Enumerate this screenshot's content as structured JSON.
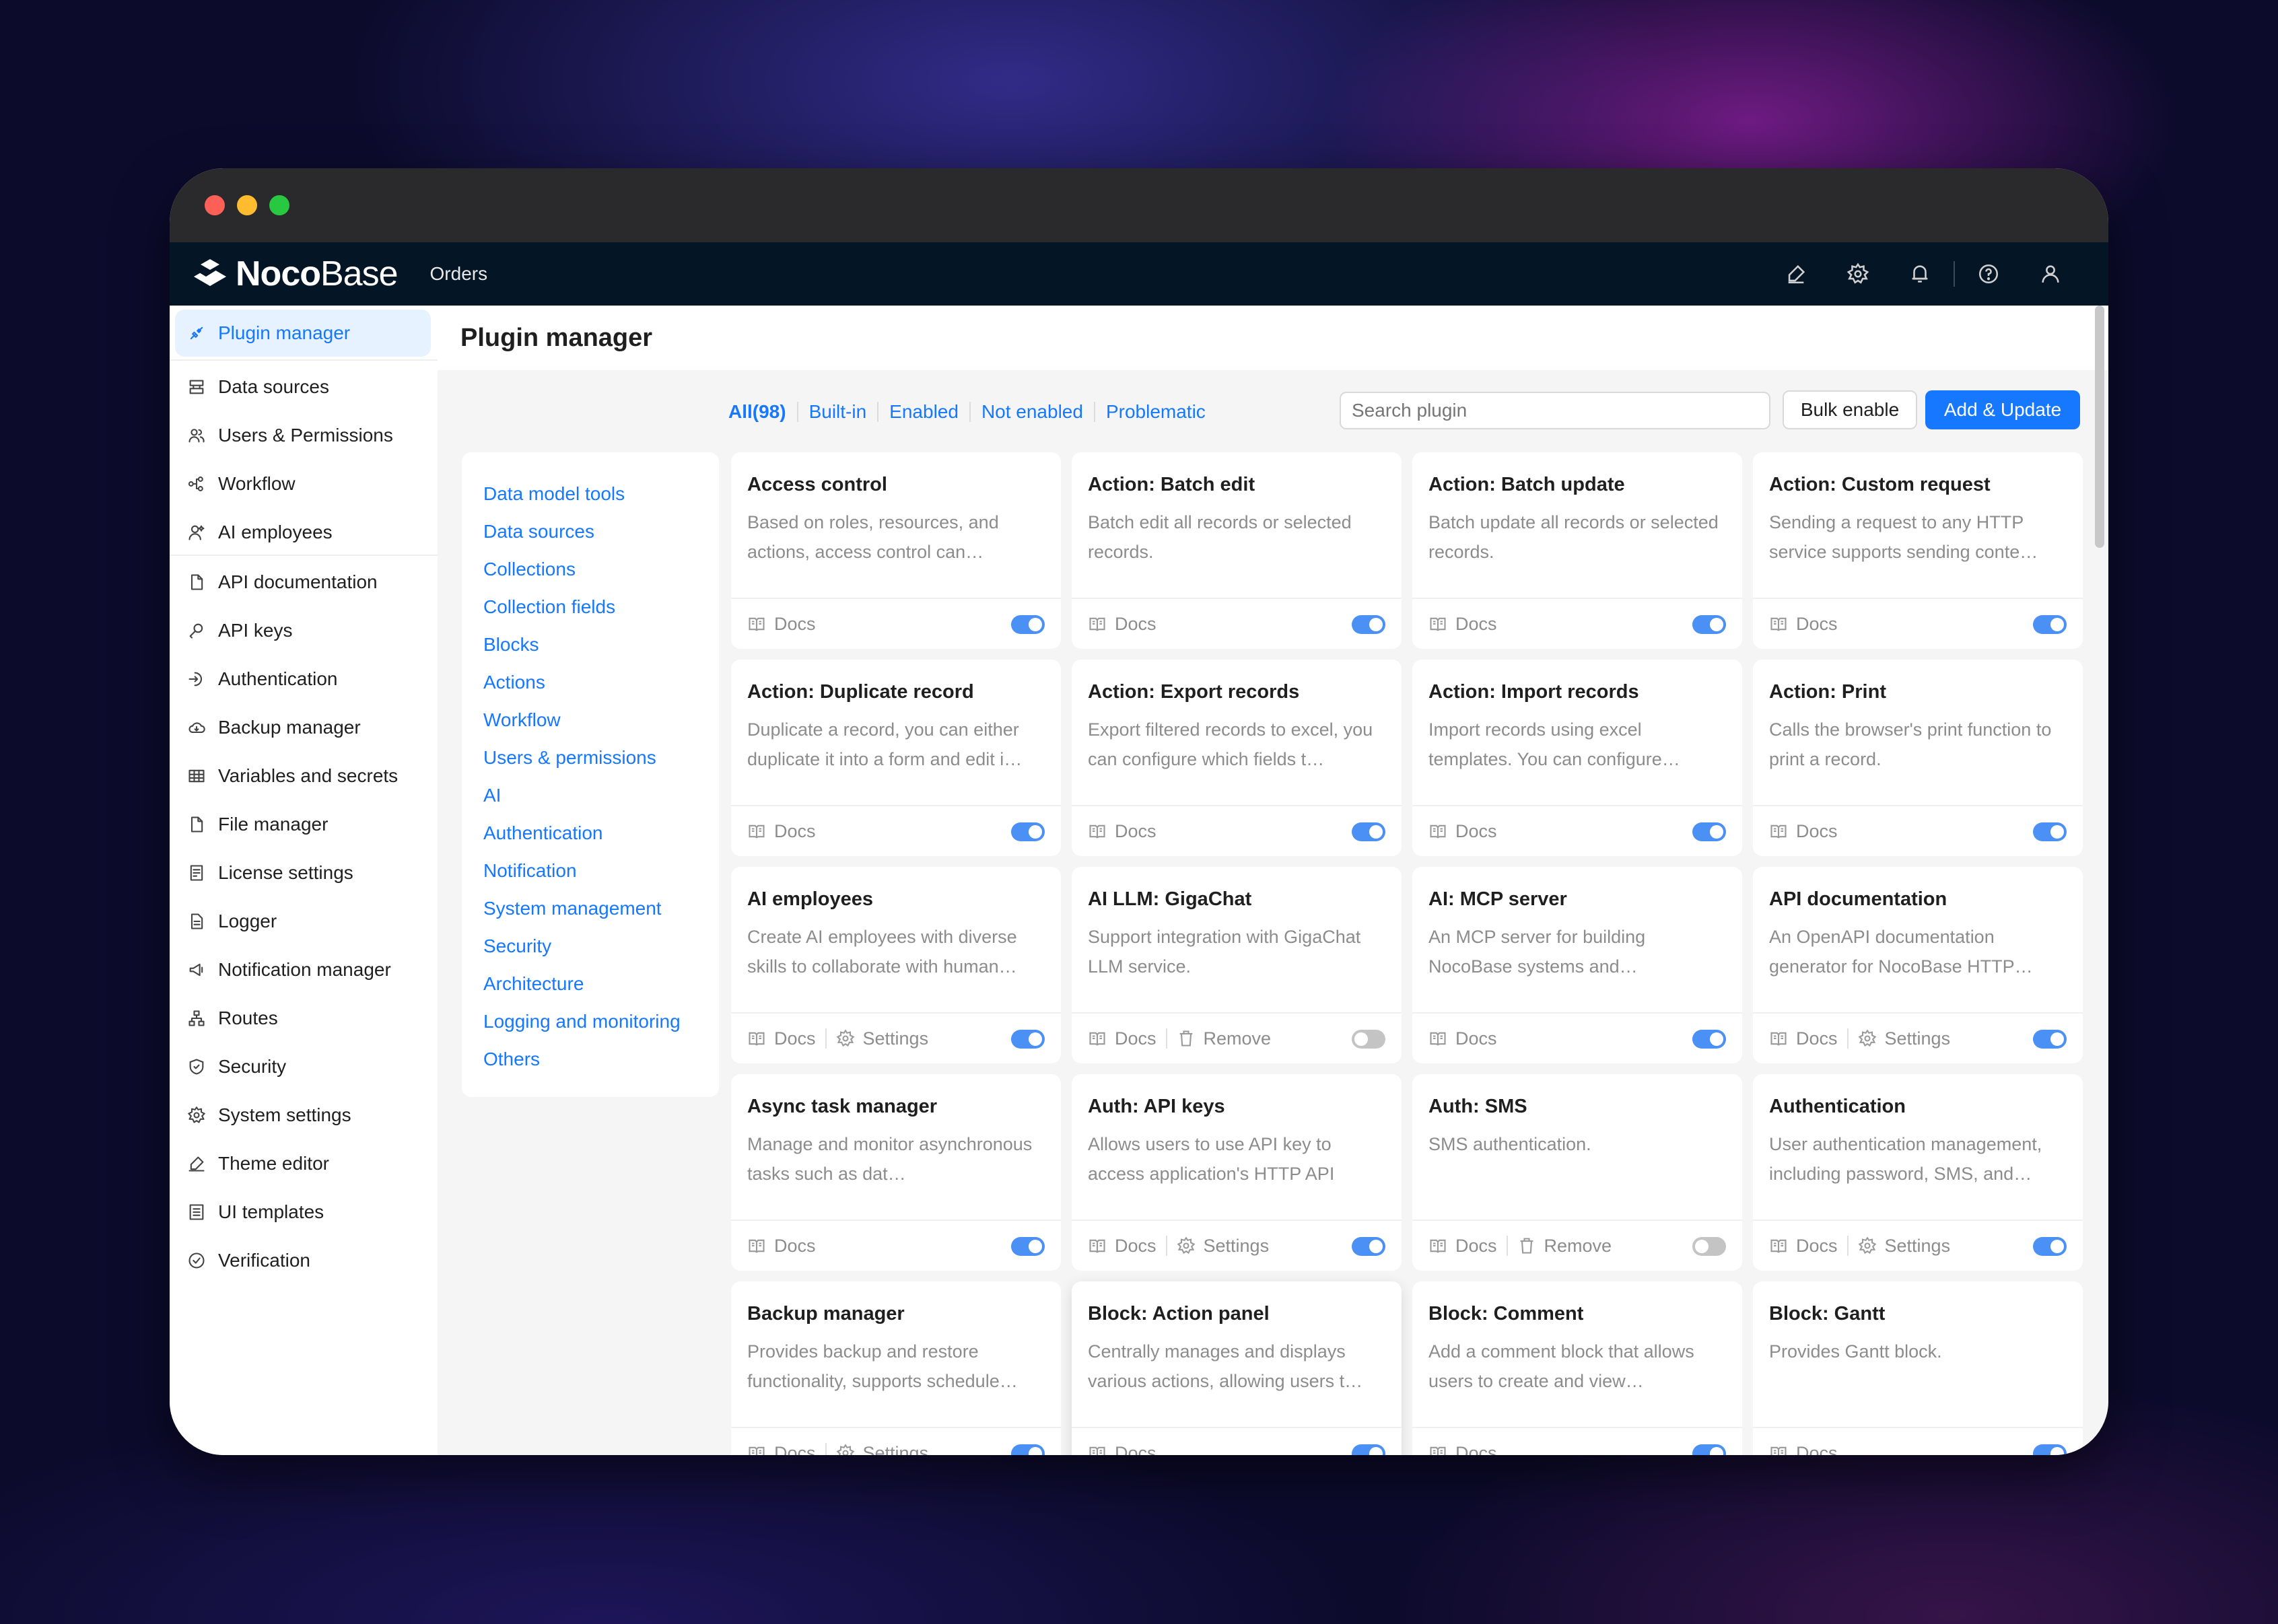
{
  "app": {
    "logo_bold": "Noco",
    "logo_light": "Base",
    "nav_item": "Orders"
  },
  "sidebar": {
    "items": [
      {
        "label": "Plugin manager",
        "icon": "plugin-icon"
      },
      {
        "label": "Data sources",
        "icon": "database-icon"
      },
      {
        "label": "Users & Permissions",
        "icon": "users-icon"
      },
      {
        "label": "Workflow",
        "icon": "workflow-icon"
      },
      {
        "label": "AI employees",
        "icon": "ai-employees-icon"
      },
      {
        "label": "API documentation",
        "icon": "document-icon"
      },
      {
        "label": "API keys",
        "icon": "key-icon"
      },
      {
        "label": "Authentication",
        "icon": "login-icon"
      },
      {
        "label": "Backup manager",
        "icon": "cloud-icon"
      },
      {
        "label": "Variables and secrets",
        "icon": "table-icon"
      },
      {
        "label": "File manager",
        "icon": "file-icon"
      },
      {
        "label": "License settings",
        "icon": "license-icon"
      },
      {
        "label": "Logger",
        "icon": "file-text-icon"
      },
      {
        "label": "Notification manager",
        "icon": "megaphone-icon"
      },
      {
        "label": "Routes",
        "icon": "routes-icon"
      },
      {
        "label": "Security",
        "icon": "shield-icon"
      },
      {
        "label": "System settings",
        "icon": "gear-icon"
      },
      {
        "label": "Theme editor",
        "icon": "brush-icon"
      },
      {
        "label": "UI templates",
        "icon": "template-icon"
      },
      {
        "label": "Verification",
        "icon": "check-circle-icon"
      }
    ]
  },
  "page": {
    "title": "Plugin manager"
  },
  "filters": [
    "All(98)",
    "Built-in",
    "Enabled",
    "Not enabled",
    "Problematic"
  ],
  "search": {
    "placeholder": "Search plugin"
  },
  "buttons": {
    "bulk": "Bulk enable",
    "add": "Add & Update"
  },
  "categories": [
    "Data model tools",
    "Data sources",
    "Collections",
    "Collection fields",
    "Blocks",
    "Actions",
    "Workflow",
    "Users & permissions",
    "AI",
    "Authentication",
    "Notification",
    "System management",
    "Security",
    "Architecture",
    "Logging and monitoring",
    "Others"
  ],
  "footer_labels": {
    "docs": "Docs",
    "settings": "Settings",
    "remove": "Remove"
  },
  "plugins": [
    {
      "title": "Access control",
      "desc": "Based on roles, resources, and actions, access control can…",
      "actions": [
        "docs"
      ],
      "enabled": true
    },
    {
      "title": "Action: Batch edit",
      "desc": "Batch edit all records or selected records.",
      "actions": [
        "docs"
      ],
      "enabled": true
    },
    {
      "title": "Action: Batch update",
      "desc": "Batch update all records or selected records.",
      "actions": [
        "docs"
      ],
      "enabled": true
    },
    {
      "title": "Action: Custom request",
      "desc": "Sending a request to any HTTP service supports sending conte…",
      "actions": [
        "docs"
      ],
      "enabled": true
    },
    {
      "title": "Action: Duplicate record",
      "desc": "Duplicate a record, you can either duplicate it into a form and edit i…",
      "actions": [
        "docs"
      ],
      "enabled": true
    },
    {
      "title": "Action: Export records",
      "desc": "Export filtered records to excel, you can configure which fields t…",
      "actions": [
        "docs"
      ],
      "enabled": true
    },
    {
      "title": "Action: Import records",
      "desc": "Import records using excel templates. You can configure…",
      "actions": [
        "docs"
      ],
      "enabled": true
    },
    {
      "title": "Action: Print",
      "desc": "Calls the browser's print function to print a record.",
      "actions": [
        "docs"
      ],
      "enabled": true
    },
    {
      "title": "AI employees",
      "desc": "Create AI employees with diverse skills to collaborate with human…",
      "actions": [
        "docs",
        "settings"
      ],
      "enabled": true
    },
    {
      "title": "AI LLM: GigaChat",
      "desc": "Support integration with GigaChat LLM service.",
      "actions": [
        "docs",
        "remove"
      ],
      "enabled": false
    },
    {
      "title": "AI: MCP server",
      "desc": "An MCP server for building NocoBase systems and…",
      "actions": [
        "docs"
      ],
      "enabled": true
    },
    {
      "title": "API documentation",
      "desc": "An OpenAPI documentation generator for NocoBase HTTP…",
      "actions": [
        "docs",
        "settings"
      ],
      "enabled": true
    },
    {
      "title": "Async task manager",
      "desc": "Manage and monitor asynchronous tasks such as dat…",
      "actions": [
        "docs"
      ],
      "enabled": true
    },
    {
      "title": "Auth: API keys",
      "desc": "Allows users to use API key to access application's HTTP API",
      "actions": [
        "docs",
        "settings"
      ],
      "enabled": true
    },
    {
      "title": "Auth: SMS",
      "desc": "SMS authentication.",
      "actions": [
        "docs",
        "remove"
      ],
      "enabled": false
    },
    {
      "title": "Authentication",
      "desc": "User authentication management, including password, SMS, and…",
      "actions": [
        "docs",
        "settings"
      ],
      "enabled": true
    },
    {
      "title": "Backup manager",
      "desc": "Provides backup and restore functionality, supports schedule…",
      "actions": [
        "docs",
        "settings"
      ],
      "enabled": true
    },
    {
      "title": "Block: Action panel",
      "desc": "Centrally manages and displays various actions, allowing users t…",
      "actions": [
        "docs"
      ],
      "enabled": true,
      "raised": true
    },
    {
      "title": "Block: Comment",
      "desc": "Add a comment block that allows users to create and view…",
      "actions": [
        "docs"
      ],
      "enabled": true
    },
    {
      "title": "Block: Gantt",
      "desc": "Provides Gantt block.",
      "actions": [
        "docs"
      ],
      "enabled": true
    }
  ]
}
